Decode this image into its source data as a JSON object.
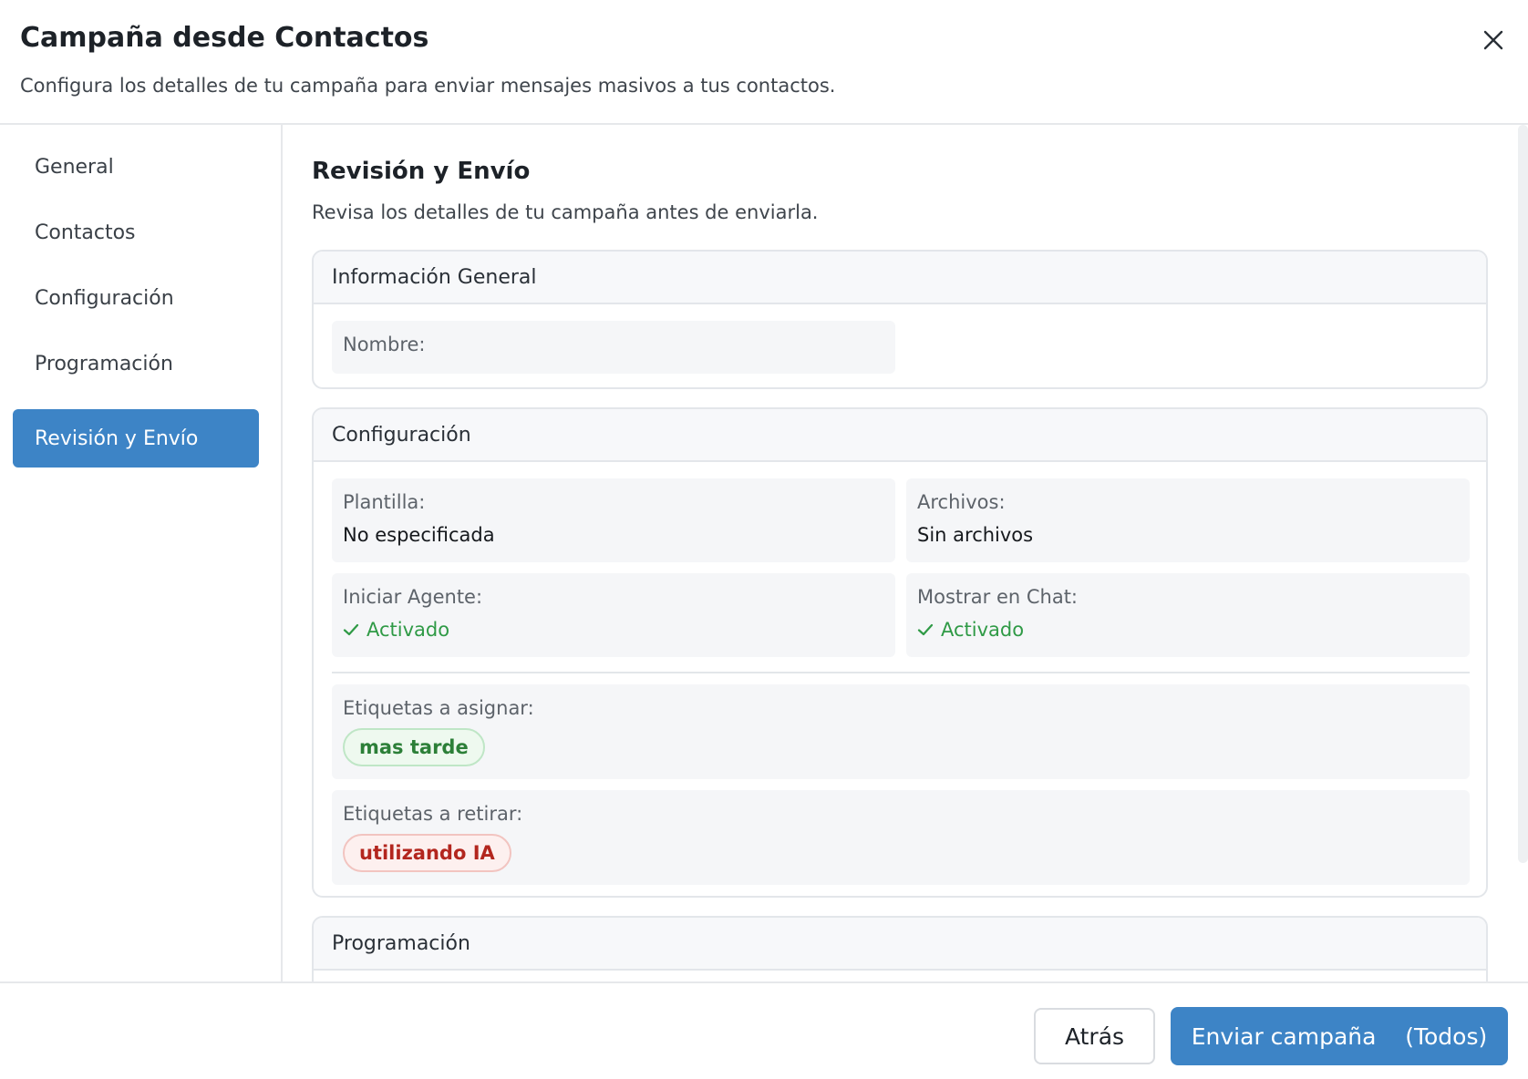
{
  "header": {
    "title": "Campaña desde Contactos",
    "subtitle": "Configura los detalles de tu campaña para enviar mensajes masivos a tus contactos.",
    "close_icon": "close-icon"
  },
  "sidebar": {
    "items": [
      {
        "label": "General",
        "active": false
      },
      {
        "label": "Contactos",
        "active": false
      },
      {
        "label": "Configuración",
        "active": false
      },
      {
        "label": "Programación",
        "active": false
      },
      {
        "label": "Revisión y Envío",
        "active": true
      }
    ]
  },
  "main": {
    "title": "Revisión y Envío",
    "description": "Revisa los detalles de tu campaña antes de enviarla.",
    "general_card": {
      "heading": "Información General",
      "name_label": "Nombre:"
    },
    "config_card": {
      "heading": "Configuración",
      "template_label": "Plantilla:",
      "template_value": "No especificada",
      "files_label": "Archivos:",
      "files_value": "Sin archivos",
      "agent_label": "Iniciar Agente:",
      "agent_value": "Activado",
      "chat_label": "Mostrar en Chat:",
      "chat_value": "Activado",
      "assign_tags_label": "Etiquetas a asignar:",
      "assign_tags": [
        "mas tarde"
      ],
      "remove_tags_label": "Etiquetas a retirar:",
      "remove_tags": [
        "utilizando IA"
      ]
    },
    "schedule_card": {
      "heading": "Programación"
    }
  },
  "footer": {
    "back_label": "Atrás",
    "send_label": "Enviar campaña    (Todos)"
  },
  "colors": {
    "accent": "#3d84c6",
    "success": "#2f9a46",
    "tag_green_text": "#2c7f38",
    "tag_red_text": "#b3261e"
  }
}
